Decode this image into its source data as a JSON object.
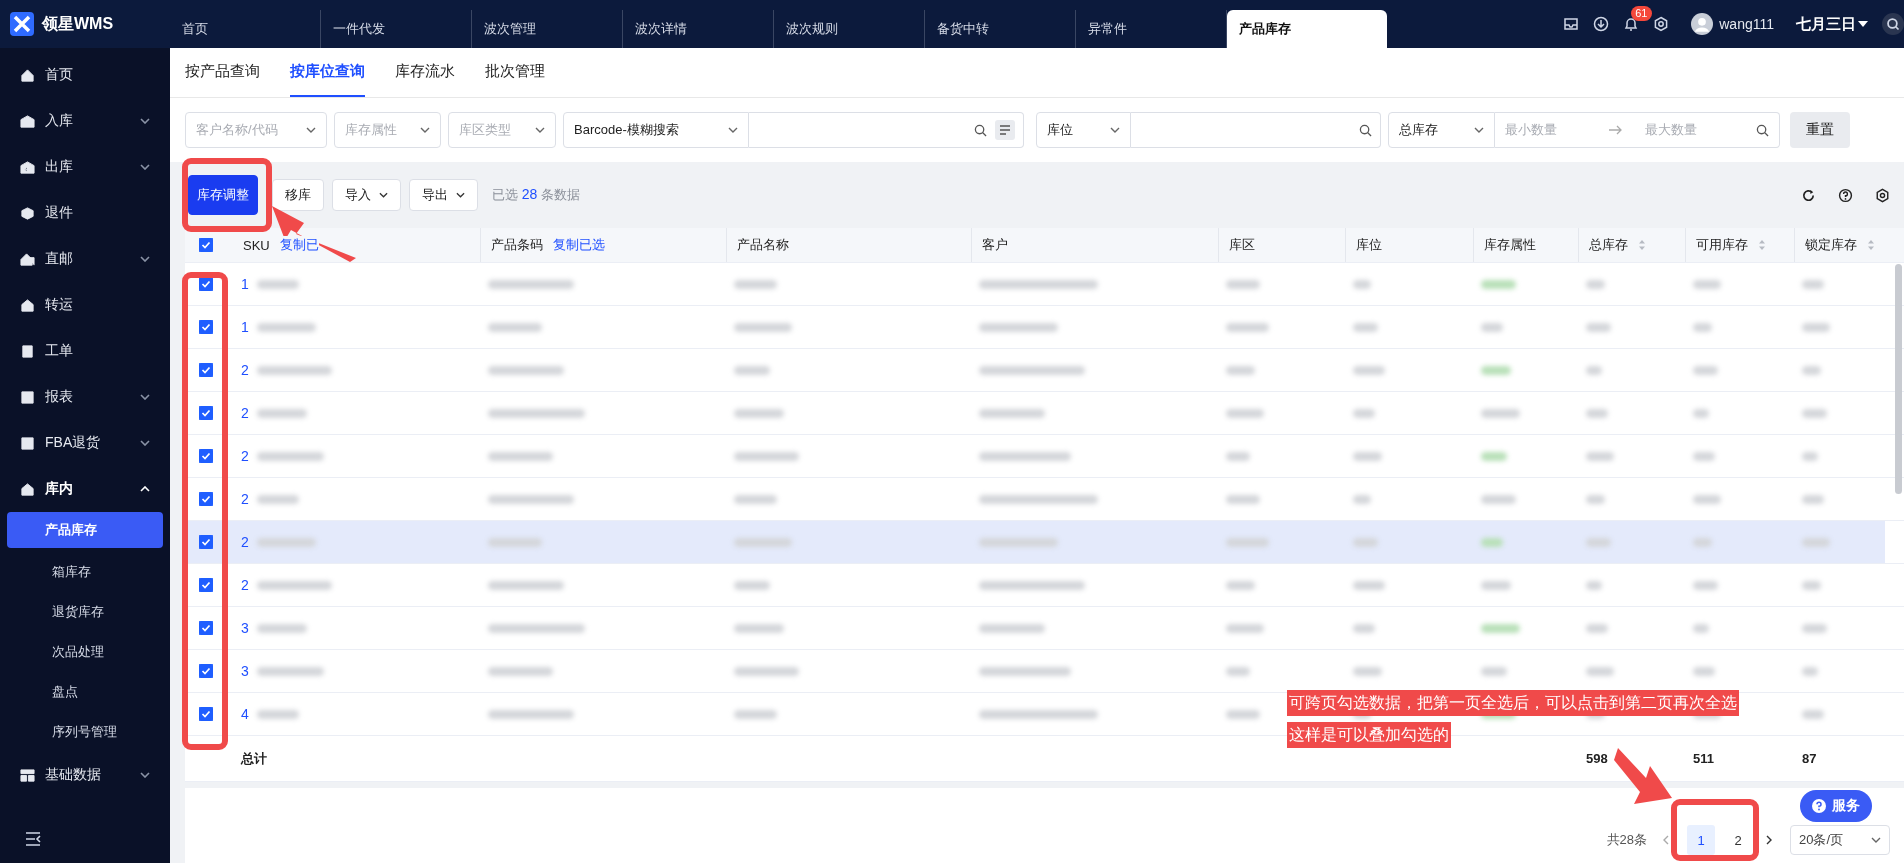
{
  "app": {
    "logo_text": "领星WMS"
  },
  "top_tabs": [
    {
      "label": "首页",
      "selected": false
    },
    {
      "label": "一件代发",
      "selected": false
    },
    {
      "label": "波次管理",
      "selected": false
    },
    {
      "label": "波次详情",
      "selected": false
    },
    {
      "label": "波次规则",
      "selected": false
    },
    {
      "label": "备货中转",
      "selected": false
    },
    {
      "label": "异常件",
      "selected": false
    },
    {
      "label": "产品库存",
      "selected": true
    }
  ],
  "top_right": {
    "notification_count": "61",
    "user": "wang111",
    "date": "七月三日"
  },
  "sidebar": {
    "items": [
      {
        "label": "首页",
        "expandable": false,
        "expanded": false
      },
      {
        "label": "入库",
        "expandable": true,
        "expanded": false
      },
      {
        "label": "出库",
        "expandable": true,
        "expanded": false
      },
      {
        "label": "退件",
        "expandable": false,
        "expanded": false
      },
      {
        "label": "直邮",
        "expandable": true,
        "expanded": false
      },
      {
        "label": "转运",
        "expandable": false,
        "expanded": false
      },
      {
        "label": "工单",
        "expandable": false,
        "expanded": false
      },
      {
        "label": "报表",
        "expandable": true,
        "expanded": false
      },
      {
        "label": "FBA退货",
        "expandable": true,
        "expanded": false
      },
      {
        "label": "库内",
        "expandable": true,
        "expanded": true,
        "children": [
          {
            "label": "产品库存",
            "selected": true
          },
          {
            "label": "箱库存",
            "selected": false
          },
          {
            "label": "退货库存",
            "selected": false
          },
          {
            "label": "次品处理",
            "selected": false
          },
          {
            "label": "盘点",
            "selected": false
          },
          {
            "label": "序列号管理",
            "selected": false
          }
        ]
      },
      {
        "label": "基础数据",
        "expandable": true,
        "expanded": false
      }
    ]
  },
  "sub_tabs": [
    {
      "label": "按产品查询",
      "selected": false
    },
    {
      "label": "按库位查询",
      "selected": true
    },
    {
      "label": "库存流水",
      "selected": false
    },
    {
      "label": "批次管理",
      "selected": false
    }
  ],
  "filters": [
    {
      "kind": "select",
      "placeholder": "客户名称/代码"
    },
    {
      "kind": "select",
      "placeholder": "库存属性"
    },
    {
      "kind": "select",
      "placeholder": "库区类型"
    },
    {
      "kind": "select-search",
      "value": "Barcode-模糊搜索",
      "list_button": true
    },
    {
      "kind": "select-search",
      "value": "库位",
      "list_button": false
    },
    {
      "kind": "range",
      "value": "总库存",
      "placeholder_min": "最小数量",
      "placeholder_max": "最大数量"
    }
  ],
  "reset_button": "重置",
  "toolbar": {
    "buttons": [
      {
        "label": "库存调整",
        "kind": "primary"
      },
      {
        "label": "移库",
        "kind": "plain"
      },
      {
        "label": "导入",
        "kind": "dropdown"
      },
      {
        "label": "导出",
        "kind": "dropdown"
      }
    ],
    "selection": {
      "prefix": "已选",
      "count": "28",
      "suffix": "条数据"
    }
  },
  "table": {
    "all_checked": true,
    "columns": [
      {
        "label": "SKU",
        "action": "复制已",
        "kind": "copy"
      },
      {
        "label": "产品条码",
        "action": "复制已选",
        "kind": "copy"
      },
      {
        "label": "产品名称",
        "kind": "plain"
      },
      {
        "label": "客户",
        "kind": "plain"
      },
      {
        "label": "库区",
        "kind": "plain"
      },
      {
        "label": "库位",
        "kind": "plain"
      },
      {
        "label": "库存属性",
        "kind": "plain"
      },
      {
        "label": "总库存",
        "kind": "sortable"
      },
      {
        "label": "可用库存",
        "kind": "sortable"
      },
      {
        "label": "锁定库存",
        "kind": "sortable"
      }
    ],
    "rows": [
      {
        "sku": "1",
        "checked": true,
        "highlighted": false
      },
      {
        "sku": "1",
        "checked": true,
        "highlighted": false
      },
      {
        "sku": "2",
        "checked": true,
        "highlighted": false
      },
      {
        "sku": "2",
        "checked": true,
        "highlighted": false
      },
      {
        "sku": "2",
        "checked": true,
        "highlighted": false
      },
      {
        "sku": "2",
        "checked": true,
        "highlighted": false
      },
      {
        "sku": "2",
        "checked": true,
        "highlighted": true
      },
      {
        "sku": "2",
        "checked": true,
        "highlighted": false
      },
      {
        "sku": "3",
        "checked": true,
        "highlighted": false
      },
      {
        "sku": "3",
        "checked": true,
        "highlighted": false
      },
      {
        "sku": "4",
        "checked": true,
        "highlighted": false
      }
    ],
    "total": {
      "label": "总计",
      "values": [
        "598",
        "511",
        "87"
      ]
    }
  },
  "pagination": {
    "total": "共28条",
    "pages": [
      {
        "label": "1",
        "selected": true
      },
      {
        "label": "2",
        "selected": false
      }
    ],
    "page_size": "20条/页"
  },
  "service_button": "服务",
  "annotation": {
    "lines": [
      "可跨页勾选数据，把第一页全选后，可以点击到第二页再次全选",
      "这样是可以叠加勾选的"
    ]
  }
}
